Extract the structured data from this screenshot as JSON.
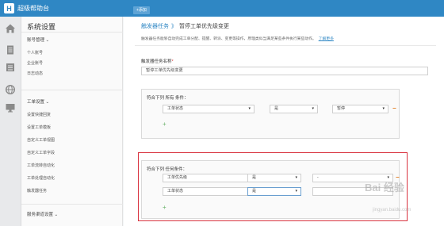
{
  "app": {
    "logo_char": "H",
    "name": "超级帮助台"
  },
  "top_tab": {
    "label": "+添加"
  },
  "sidebar": {
    "title": "系统设置",
    "sections": [
      {
        "label": "账号管理 ⌄",
        "items": [
          "个人账号",
          "企业账号",
          "日志动态"
        ]
      },
      {
        "label": "工单设置 ⌄",
        "items": [
          "设置快捷回复",
          "设置工单模板",
          "自定义工单视图",
          "自定义工单字段",
          "工单流转自动化",
          "工单处理自动化",
          "触发器任务"
        ]
      },
      {
        "label": "服务渠道设置 ⌄",
        "items": []
      }
    ]
  },
  "breadcrumb": {
    "parent": "触发器任务",
    "arrow": "》",
    "current": "暂停工单优先级变更"
  },
  "description": {
    "text": "触发器任务能够自动完成工单分配、提醒、转派、变更等操作，原理类似当满足某些条件执行某些动作。",
    "more": "了解更多"
  },
  "form": {
    "name_label": "触发器任务名称",
    "required_mark": "*",
    "name_value": "暂停工单优先级变更",
    "all_conditions": {
      "title": "符合下列 所有 条件：",
      "rows": [
        {
          "field": "工单状态",
          "op": "是",
          "value": "暂停"
        }
      ],
      "add": "+",
      "remove": "−"
    },
    "any_conditions": {
      "title": "符合下列 任何条件：",
      "rows": [
        {
          "field": "工单优先级",
          "op": "是",
          "value": "-"
        },
        {
          "field": "工单状态",
          "op": "是",
          "value": ""
        }
      ],
      "add": "+",
      "remove": "−"
    }
  },
  "caret": "▾",
  "watermark": {
    "main": "Bai 经验",
    "sub": "jingyan.baidu.com"
  },
  "colors": {
    "topbar": "#2f87c4",
    "highlight": "#d9333f",
    "minus": "#e07a1f",
    "plus": "#6bb26b"
  }
}
